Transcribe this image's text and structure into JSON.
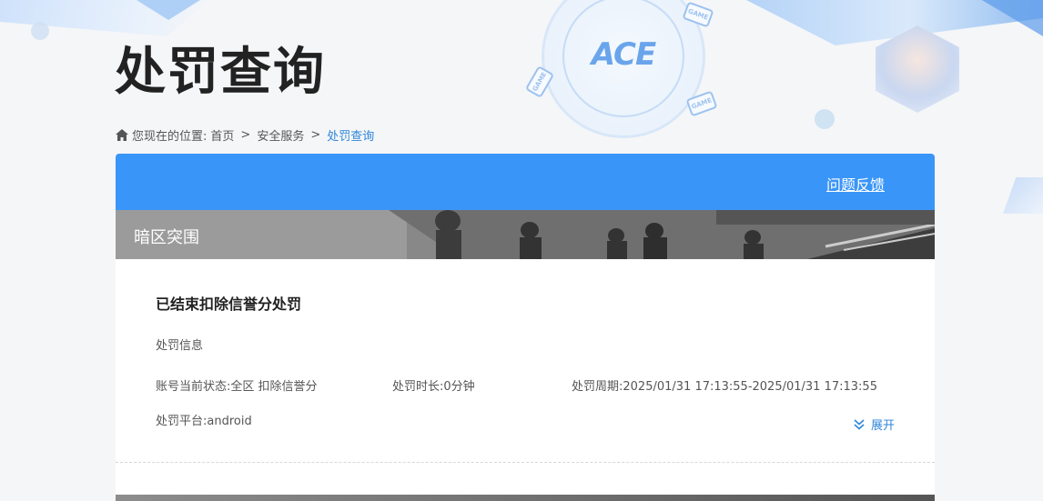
{
  "page": {
    "title": "处罚查询",
    "logo_text": "ACE",
    "game_tag": "GAME"
  },
  "breadcrumb": {
    "prefix": "您现在的位置:",
    "items": [
      "首页",
      "安全服务",
      "处罚查询"
    ],
    "separator": ">"
  },
  "card": {
    "feedback_link": "问题反馈",
    "game_name": "暗区突围"
  },
  "record": {
    "title": "已结束扣除信誉分处罚",
    "section_label": "处罚信息",
    "account_status": "账号当前状态:全区 扣除信誉分",
    "duration": "处罚时长:0分钟",
    "period": "处罚周期:2025/01/31 17:13:55-2025/01/31 17:13:55",
    "platform": "处罚平台:android",
    "expand_label": "展开"
  },
  "colors": {
    "accent": "#3a95f8",
    "link": "#2f86d8"
  }
}
